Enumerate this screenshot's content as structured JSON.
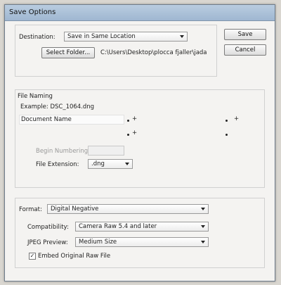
{
  "window": {
    "title": "Save Options"
  },
  "destination": {
    "label": "Destination:",
    "value": "Save in Same Location",
    "select_folder_label": "Select Folder...",
    "path": "C:\\Users\\Desktop\\plocca fjaller\\jada"
  },
  "actions": {
    "save_label": "Save",
    "cancel_label": "Cancel"
  },
  "file_naming": {
    "heading": "File Naming",
    "example": "Example: DSC_1064.dng",
    "doc_name_value": "Document Name",
    "begin_numbering_label": "Begin Numbering:",
    "begin_numbering_value": "",
    "file_extension_label": "File Extension:",
    "file_extension_value": ".dng"
  },
  "format": {
    "format_label": "Format:",
    "format_value": "Digital Negative",
    "compatibility_label": "Compatibility:",
    "compatibility_value": "Camera Raw 5.4 and later",
    "jpeg_preview_label": "JPEG Preview:",
    "jpeg_preview_value": "Medium Size",
    "embed_raw_label": "Embed Original Raw File",
    "embed_raw_checked": true
  }
}
